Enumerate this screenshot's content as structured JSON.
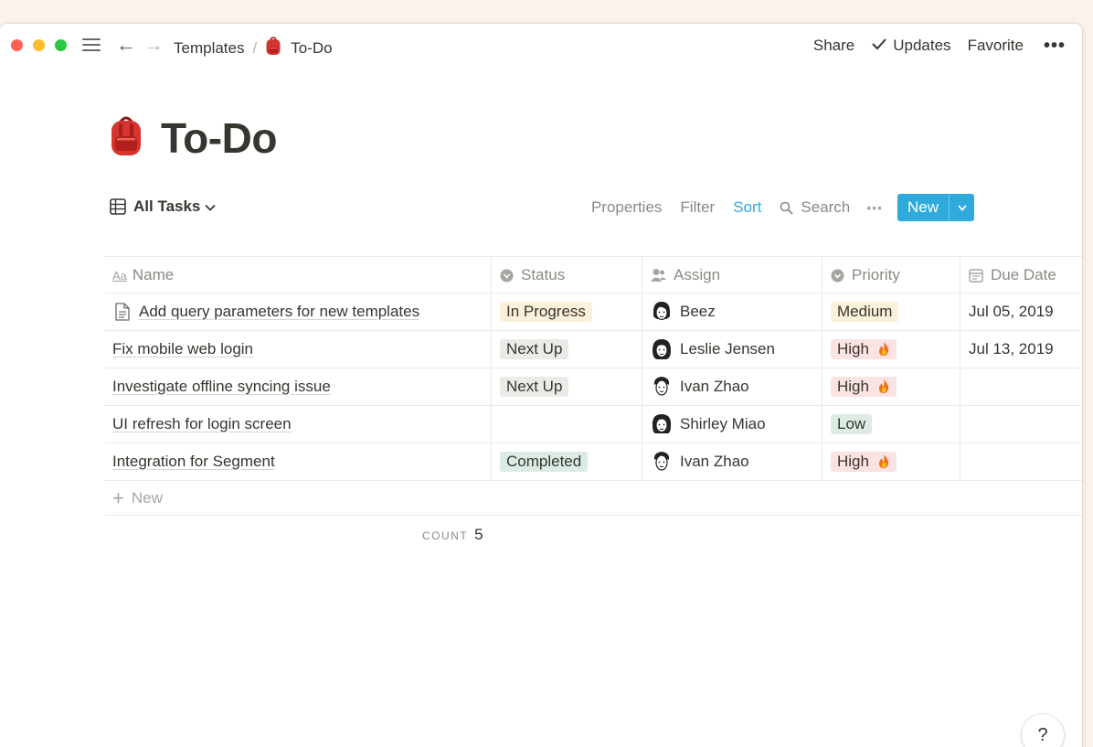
{
  "topbar": {
    "breadcrumb_parent": "Templates",
    "breadcrumb_sep": "/",
    "breadcrumb_current": "To-Do",
    "share": "Share",
    "updates": "Updates",
    "favorite": "Favorite",
    "more": "•••"
  },
  "page": {
    "icon": "backpack-icon",
    "title": "To-Do"
  },
  "view": {
    "name": "All Tasks",
    "properties": "Properties",
    "filter": "Filter",
    "sort": "Sort",
    "search": "Search",
    "more": "•••",
    "new": "New",
    "accent_color": "#2eaadc"
  },
  "table": {
    "columns": [
      {
        "label": "Name",
        "icon": "aa-text-icon"
      },
      {
        "label": "Status",
        "icon": "select-icon"
      },
      {
        "label": "Assign",
        "icon": "person-icon"
      },
      {
        "label": "Priority",
        "icon": "select-icon"
      },
      {
        "label": "Due Date",
        "icon": "calendar-icon"
      }
    ],
    "rows": [
      {
        "name": "Add query parameters for new templates",
        "status": "In Progress",
        "assign": "Beez",
        "priority": "Medium",
        "due": "Jul 05, 2019"
      },
      {
        "name": "Fix mobile web login",
        "status": "Next Up",
        "assign": "Leslie Jensen",
        "priority": "High",
        "due": "Jul 13, 2019"
      },
      {
        "name": "Investigate offline syncing issue",
        "status": "Next Up",
        "assign": "Ivan Zhao",
        "priority": "High",
        "due": ""
      },
      {
        "name": "UI refresh for login screen",
        "status": "",
        "assign": "Shirley Miao",
        "priority": "Low",
        "due": ""
      },
      {
        "name": "Integration for Segment",
        "status": "Completed",
        "assign": "Ivan Zhao",
        "priority": "High",
        "due": ""
      }
    ],
    "new_row": "New",
    "count_label": "COUNT",
    "count_value": "5"
  },
  "help": "?",
  "colors": {
    "tag_yellow": "#fbf0d9",
    "tag_gray": "#ebeae6",
    "tag_green": "#dcece5",
    "tag_red": "#fbe2e3"
  }
}
